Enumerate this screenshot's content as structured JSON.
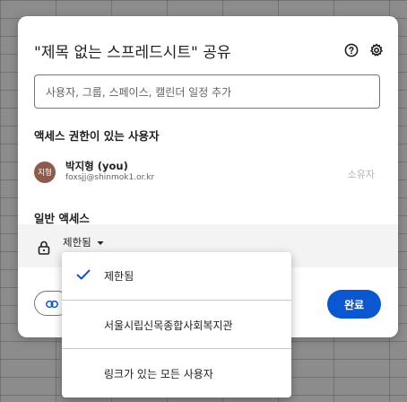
{
  "dialog": {
    "title": "\"제목 없는 스프레드시트\" 공유",
    "help_icon": "help-circle-icon",
    "settings_icon": "gear-icon",
    "search_placeholder": "사용자, 그룹, 스페이스, 캘린더 일정 추가",
    "people_section_title": "액세스 권한이 있는 사용자",
    "people": [
      {
        "avatar_text": "지형",
        "name": "박지형 (you)",
        "email": "foxsjj@shinmok1.or.kr",
        "role": "소유자"
      }
    ],
    "general_access_title": "일반 액세스",
    "general_access_value": "제한됨",
    "copy_link_icon": "link-icon",
    "done_label": "완료",
    "colors": {
      "accent": "#0b57d0",
      "avatar": "#8d5a4c"
    }
  },
  "access_menu": {
    "options": [
      {
        "label": "제한됨",
        "selected": true
      },
      {
        "label": "서울시립신목종합사회복지관",
        "selected": false
      },
      {
        "label": "링크가 있는 모든 사용자",
        "selected": false
      }
    ]
  }
}
